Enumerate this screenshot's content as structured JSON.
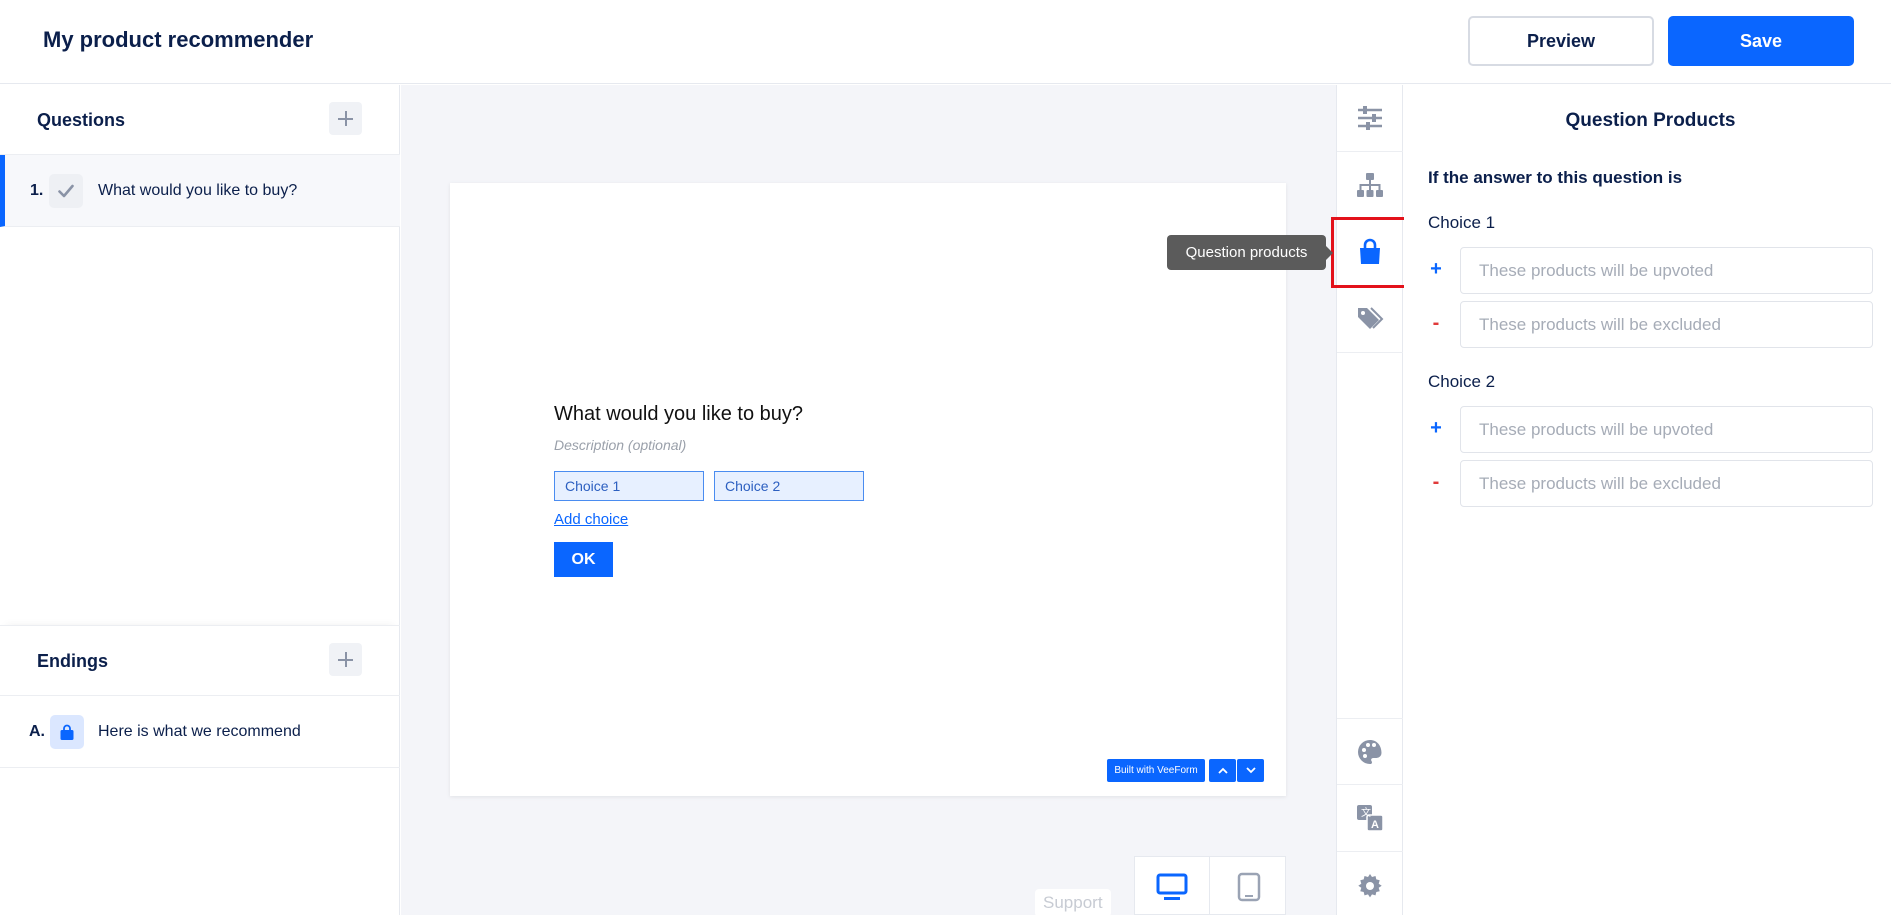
{
  "header": {
    "title": "My product recommender",
    "preview_label": "Preview",
    "save_label": "Save"
  },
  "sidebar": {
    "questions_title": "Questions",
    "questions": [
      {
        "number": "1.",
        "icon": "check-icon",
        "label": "What would you like to buy?"
      }
    ],
    "endings_title": "Endings",
    "endings": [
      {
        "number": "A.",
        "icon": "shopping-bag-icon",
        "label": "Here is what we recommend"
      }
    ]
  },
  "canvas": {
    "question": "What would you like to buy?",
    "description_placeholder": "Description (optional)",
    "choices": [
      "Choice 1",
      "Choice 2"
    ],
    "add_choice_label": "Add choice",
    "ok_label": "OK",
    "built_with": "Built with VeeForm",
    "support_label": "Support"
  },
  "rail": {
    "tooltip": "Question products",
    "icons": [
      "sliders-icon",
      "sitemap-icon",
      "shopping-bag-icon",
      "tag-icon",
      "palette-icon",
      "translate-icon",
      "gear-icon"
    ]
  },
  "panel": {
    "title": "Question Products",
    "subtitle": "If the answer to this question is",
    "choices": [
      {
        "label": "Choice 1",
        "upvote_placeholder": "These products will be upvoted",
        "exclude_placeholder": "These products will be excluded"
      },
      {
        "label": "Choice 2",
        "upvote_placeholder": "These products will be upvoted",
        "exclude_placeholder": "These products will be excluded"
      }
    ],
    "plus_sign": "+",
    "minus_sign": "-"
  },
  "colors": {
    "accent": "#0a66ff",
    "text": "#0b1f4b",
    "highlight": "#e3121b",
    "minus": "#e03a3a"
  }
}
